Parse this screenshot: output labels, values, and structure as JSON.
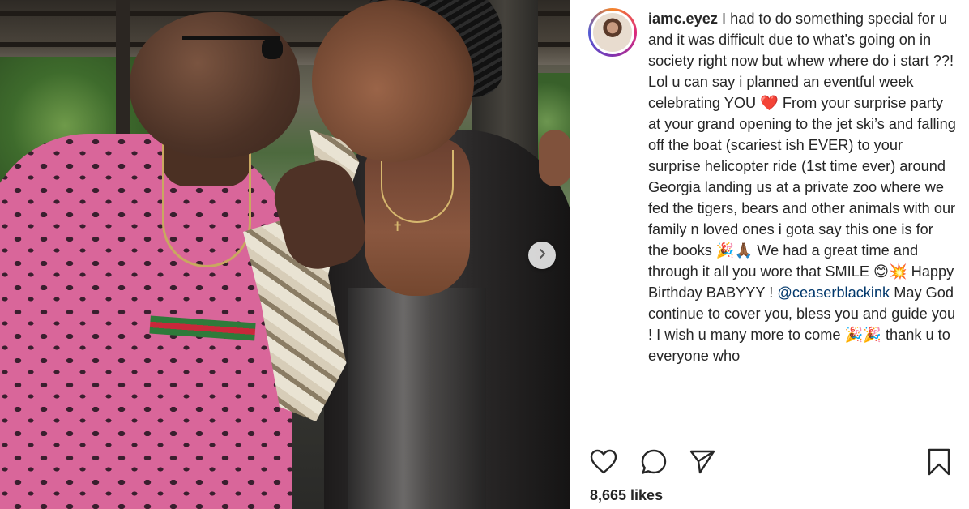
{
  "post": {
    "username": "iamc.eyez",
    "caption_parts": {
      "intro": " I had to do something special for u and it was difficult due to what’s going on in society right now but whew where do i start ??! Lol u can say i planned an eventful week celebrating YOU ",
      "heart": "❤️",
      "middle": " From your surprise party at your grand opening to the jet ski’s and falling off the boat (scariest ish EVER) to your surprise helicopter ride (1st time ever) around Georgia landing us at a private zoo where we fed the tigers, bears and other animals with our family n loved ones i gota say this one is for the books ",
      "emoji1": "🎉🙏🏾",
      "part3": " We had a great time and through it all you wore that SMILE ",
      "emoji2": "😊💥",
      "part4": " Happy Birthday BABYYY ! ",
      "mention": "@ceaserblackink",
      "part5": " May God continue to cover you, bless you and guide you ! I wish u many more to come ",
      "emoji3": "🎉🎉",
      "part6": " thank u to everyone who"
    },
    "likes_label": "8,665 likes"
  },
  "icons": {
    "like": "heart-outline-icon",
    "comment": "comment-bubble-icon",
    "share": "paper-plane-icon",
    "save": "bookmark-icon",
    "next": "chevron-right-icon"
  },
  "colors": {
    "text": "#262626",
    "mention": "#00376b",
    "heart": "#ed2b3b"
  }
}
